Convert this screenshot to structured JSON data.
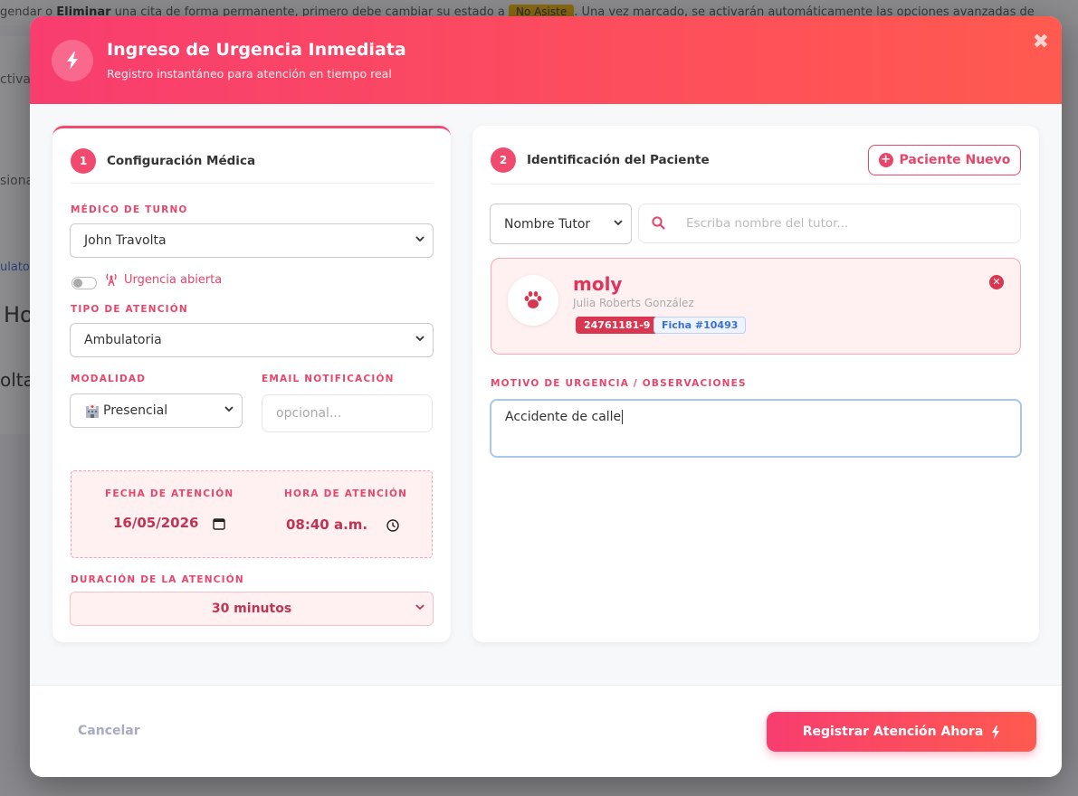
{
  "background": {
    "notice_text_1": "gendar o ",
    "notice_bold_1": "Eliminar",
    "notice_text_2": " una cita de forma permanente, primero debe cambiar su estado a ",
    "notice_badge": "No Asiste",
    "notice_text_3": ". Una vez marcado, se activarán automáticamente las opciones avanzadas de",
    "fragment_1": "ctiva",
    "fragment_2": "siona",
    "fragment_3": "ulator",
    "fragment_4": "Ho",
    "fragment_5": "olta"
  },
  "modal": {
    "title": "Ingreso de Urgencia Inmediata",
    "subtitle": "Registro instantáneo para atención en tiempo real",
    "close_glyph": "✖"
  },
  "left_card": {
    "step_number": "1",
    "step_title": "Configuración Médica",
    "doctor_label": "MÉDICO DE TURNO",
    "doctor_value": "John Travolta",
    "urgency_toggle_label": "Urgencia abierta",
    "attention_type_label": "TIPO DE ATENCIÓN",
    "attention_type_value": "Ambulatoria",
    "modality_label": "MODALIDAD",
    "modality_value": "Presencial",
    "email_label": "EMAIL NOTIFICACIÓN",
    "email_placeholder": "opcional...",
    "date_label": "FECHA DE ATENCIÓN",
    "date_value": "16/05/2026",
    "time_label": "HORA DE ATENCIÓN",
    "time_value": "08:40 a.m.",
    "duration_label": "DURACIÓN DE LA ATENCIÓN",
    "duration_value": "30 minutos"
  },
  "right_card": {
    "step_number": "2",
    "step_title": "Identificación del Paciente",
    "new_patient_button": "Paciente Nuevo",
    "search_type_value": "Nombre Tutor",
    "search_placeholder": "Escriba nombre del tutor...",
    "patient": {
      "name": "moly",
      "owner": "Julia Roberts González",
      "rut": "24761181-9",
      "file": "Ficha #10493"
    },
    "reason_label": "MOTIVO DE URGENCIA / OBSERVACIONES",
    "reason_value": "Accidente de calle"
  },
  "footer": {
    "cancel_label": "Cancelar",
    "submit_label": "Registrar Atención Ahora"
  },
  "colors": {
    "accent": "#f04b6e",
    "header_gradient_start": "#f83d6f",
    "header_gradient_end": "#ff5a4f",
    "tag_red": "#d9374f",
    "tag_blue": "#3b6fd4"
  },
  "icons": {
    "header": "lightning-icon",
    "doctor_select": "chevron-down-icon",
    "urgency": "broadcast-tower-icon",
    "modality": "hospital-icon",
    "date": "calendar-icon",
    "time": "clock-icon",
    "new_patient": "plus-circle-icon",
    "search": "search-icon",
    "avatar": "paw-icon",
    "remove": "times-circle-icon",
    "submit": "lightning-icon"
  }
}
